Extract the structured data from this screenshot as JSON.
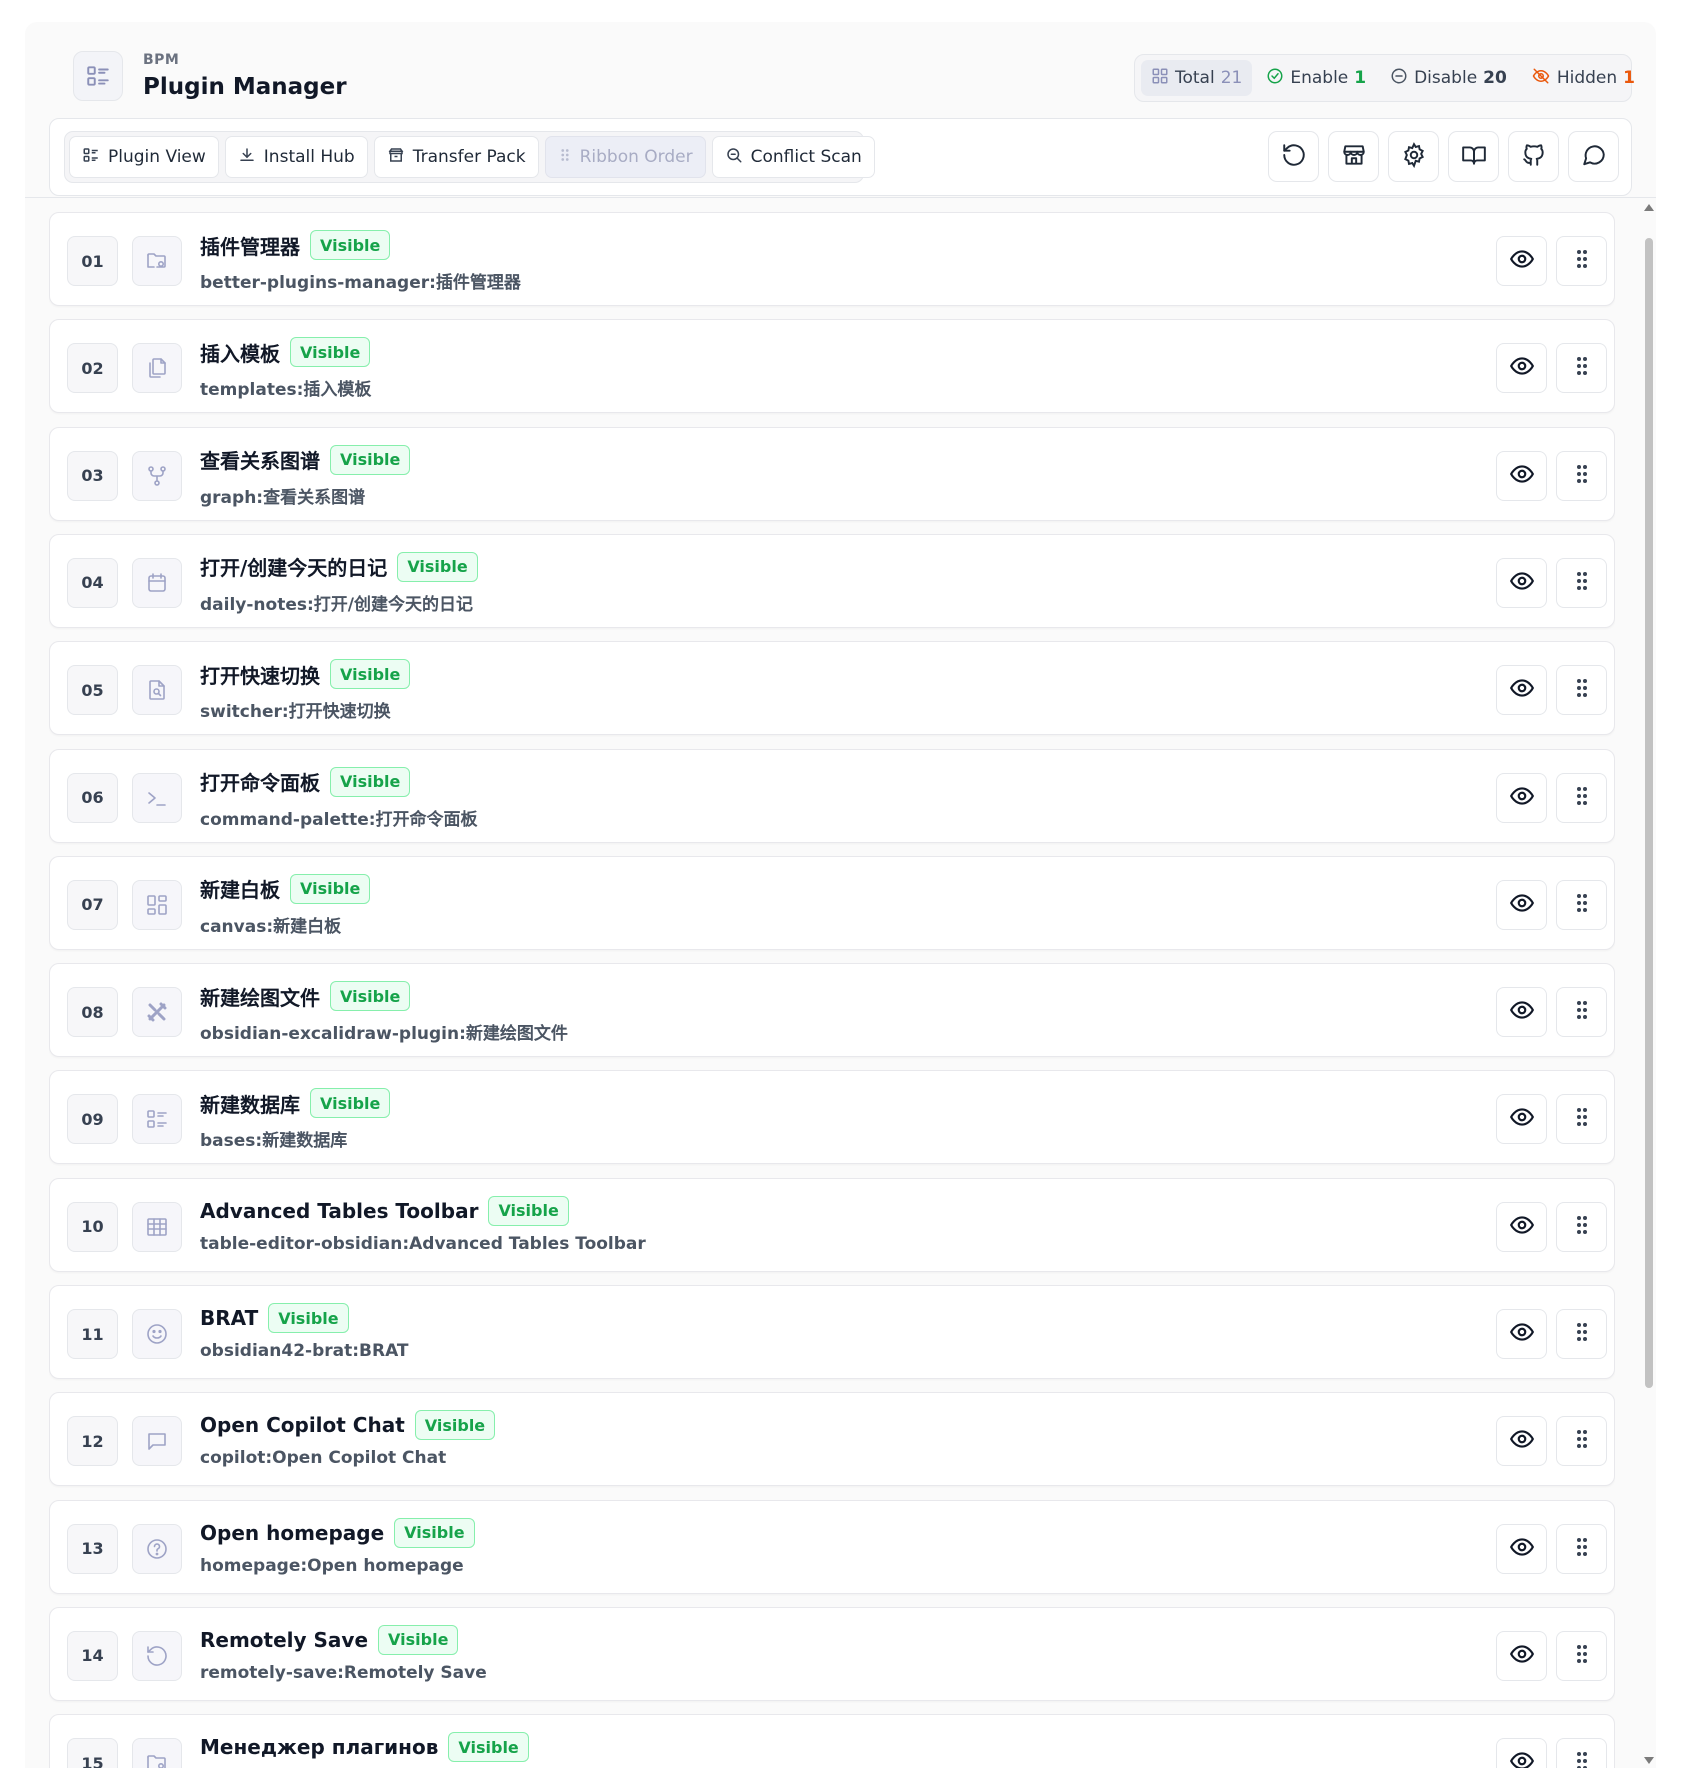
{
  "app": {
    "subtitle": "BPM",
    "title": "Plugin Manager"
  },
  "stats": [
    {
      "key": "total",
      "label": "Total",
      "value": "21",
      "icon": "grid-icon"
    },
    {
      "key": "enable",
      "label": "Enable",
      "value": "1",
      "icon": "check-circle-icon"
    },
    {
      "key": "disable",
      "label": "Disable",
      "value": "20",
      "icon": "minus-circle-icon"
    },
    {
      "key": "hidden",
      "label": "Hidden",
      "value": "1",
      "icon": "eye-off-icon"
    }
  ],
  "nav": [
    {
      "label": "Plugin View",
      "icon": "list-icon",
      "active": false
    },
    {
      "label": "Install Hub",
      "icon": "download-icon",
      "active": false
    },
    {
      "label": "Transfer Pack",
      "icon": "package-icon",
      "active": false
    },
    {
      "label": "Ribbon Order",
      "icon": "grip-icon",
      "active": true
    },
    {
      "label": "Conflict Scan",
      "icon": "search-icon",
      "active": false
    }
  ],
  "tools": [
    {
      "name": "refresh-button",
      "icon": "refresh-icon"
    },
    {
      "name": "store-button",
      "icon": "store-icon"
    },
    {
      "name": "settings-button",
      "icon": "gear-icon"
    },
    {
      "name": "docs-button",
      "icon": "book-icon"
    },
    {
      "name": "github-button",
      "icon": "github-icon"
    },
    {
      "name": "feedback-button",
      "icon": "chat-icon"
    }
  ],
  "badge_label": "Visible",
  "rows": [
    {
      "index": "01",
      "title": "插件管理器",
      "id": "better-plugins-manager:插件管理器",
      "icon": "folder-cog-icon"
    },
    {
      "index": "02",
      "title": "插入模板",
      "id": "templates:插入模板",
      "icon": "files-icon"
    },
    {
      "index": "03",
      "title": "查看关系图谱",
      "id": "graph:查看关系图谱",
      "icon": "git-fork-icon"
    },
    {
      "index": "04",
      "title": "打开/创建今天的日记",
      "id": "daily-notes:打开/创建今天的日记",
      "icon": "calendar-icon"
    },
    {
      "index": "05",
      "title": "打开快速切换",
      "id": "switcher:打开快速切换",
      "icon": "file-search-icon"
    },
    {
      "index": "06",
      "title": "打开命令面板",
      "id": "command-palette:打开命令面板",
      "icon": "terminal-icon"
    },
    {
      "index": "07",
      "title": "新建白板",
      "id": "canvas:新建白板",
      "icon": "layout-dashboard-icon"
    },
    {
      "index": "08",
      "title": "新建绘图文件",
      "id": "obsidian-excalidraw-plugin:新建绘图文件",
      "icon": "excalidraw-icon"
    },
    {
      "index": "09",
      "title": "新建数据库",
      "id": "bases:新建数据库",
      "icon": "list-icon"
    },
    {
      "index": "10",
      "title": "Advanced Tables Toolbar",
      "id": "table-editor-obsidian:Advanced Tables Toolbar",
      "icon": "table-icon"
    },
    {
      "index": "11",
      "title": "BRAT",
      "id": "obsidian42-brat:BRAT",
      "icon": "smile-icon"
    },
    {
      "index": "12",
      "title": "Open Copilot Chat",
      "id": "copilot:Open Copilot Chat",
      "icon": "message-square-icon"
    },
    {
      "index": "13",
      "title": "Open homepage",
      "id": "homepage:Open homepage",
      "icon": "help-circle-icon"
    },
    {
      "index": "14",
      "title": "Remotely Save",
      "id": "remotely-save:Remotely Save",
      "icon": "refresh-icon"
    },
    {
      "index": "15",
      "title": "Менеджер плагинов",
      "id": "",
      "icon": "folder-cog-icon"
    }
  ],
  "colors": {
    "accent": "#a8acc4",
    "success": "#16a34a",
    "warning": "#ea580c",
    "icon": "#8b90b8"
  }
}
